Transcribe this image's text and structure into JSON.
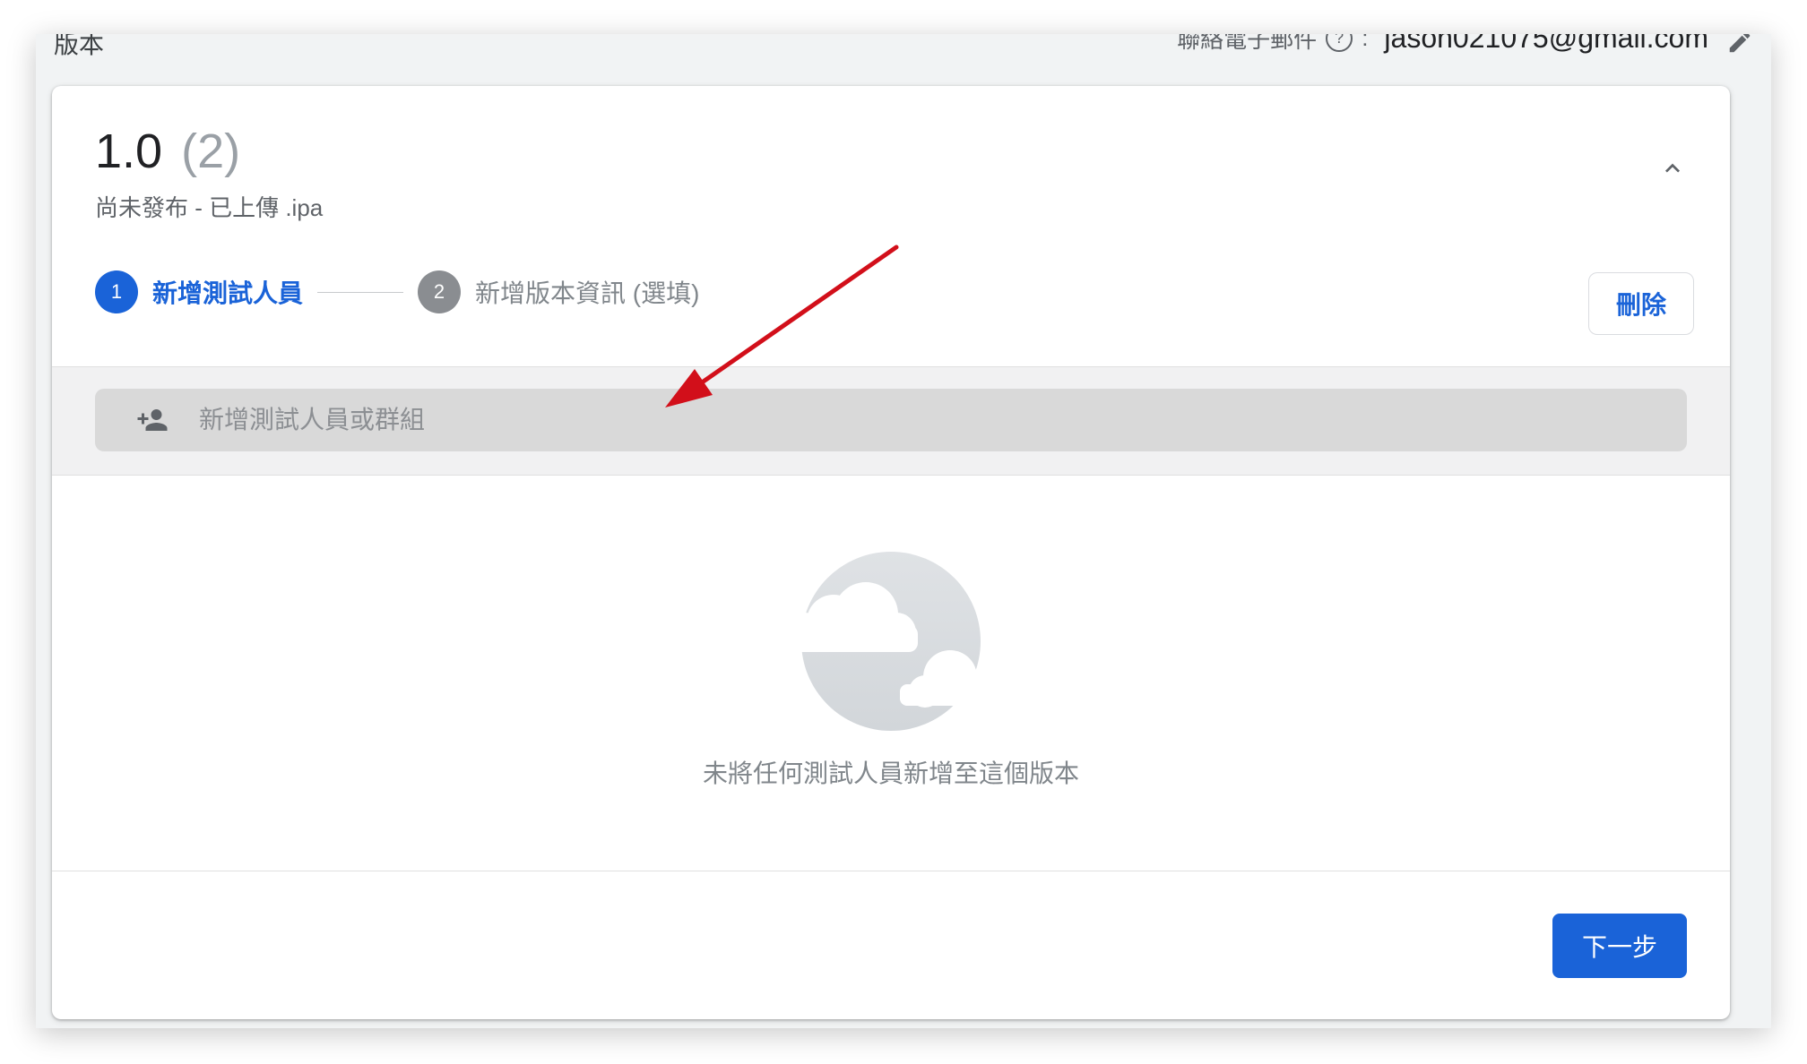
{
  "header": {
    "version_label": "版本",
    "contact_label": "聯絡電子郵件",
    "contact_email": "jason021075@gmail.com"
  },
  "version_card": {
    "title": "1.0",
    "build_count": "(2)",
    "status": "尚未發布 - 已上傳 .ipa"
  },
  "stepper": {
    "steps": [
      {
        "number": "1",
        "label": "新增測試人員",
        "state": "active"
      },
      {
        "number": "2",
        "label": "新增版本資訊 (選填)",
        "state": "inactive"
      }
    ]
  },
  "actions": {
    "delete_label": "刪除",
    "next_label": "下一步"
  },
  "search": {
    "placeholder": "新增測試人員或群組",
    "value": ""
  },
  "empty_state": {
    "message": "未將任何測試人員新增至這個版本"
  },
  "colors": {
    "accent": "#1a63d8",
    "annotation_arrow": "#d20f1a"
  },
  "icons": [
    "help-circle-icon",
    "edit-pencil-icon",
    "chevron-up-icon",
    "add-person-icon",
    "cloud-illustration",
    "annotation-arrow"
  ]
}
